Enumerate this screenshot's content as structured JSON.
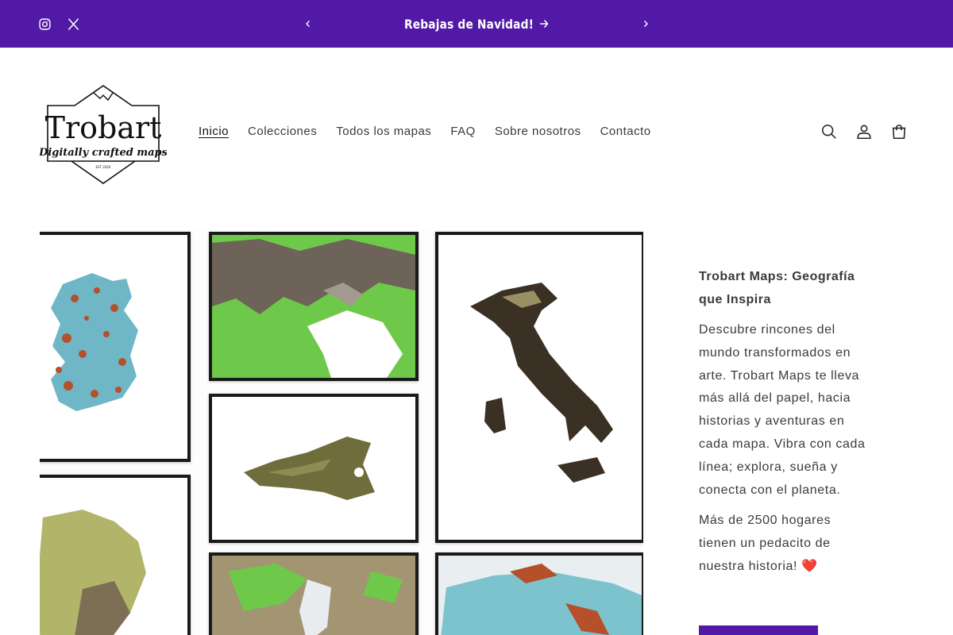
{
  "announcement": {
    "message": "Rebajas de Navidad!",
    "social": [
      "instagram-icon",
      "x-twitter-icon"
    ],
    "prev_icon": "chevron-left-icon",
    "next_icon": "chevron-right-icon",
    "arrow_icon": "arrow-right-icon"
  },
  "logo": {
    "title": "Trobart",
    "tagline": "Digitally crafted maps",
    "est": "EST 2020"
  },
  "nav": {
    "items": [
      {
        "label": "Inicio",
        "active": true
      },
      {
        "label": "Colecciones",
        "active": false
      },
      {
        "label": "Todos los mapas",
        "active": false
      },
      {
        "label": "FAQ",
        "active": false
      },
      {
        "label": "Sobre nosotros",
        "active": false
      },
      {
        "label": "Contacto",
        "active": false
      }
    ]
  },
  "header_icons": [
    "search-icon",
    "account-icon",
    "cart-icon"
  ],
  "hero": {
    "heading": "Trobart Maps: Geografía que Inspira",
    "paragraph1": "Descubre rincones del mundo transformados en arte. Trobart Maps te lleva más allá del papel, hacia historias y aventuras en cada mapa. Vibra con cada línea; explora, sueña y conecta con el planeta.",
    "paragraph2": "Más de 2500 hogares tienen un pedacito de nuestra historia! ❤️",
    "image": "framed-relief-maps-collage"
  },
  "colors": {
    "brand_purple": "#5119a6",
    "text": "#3a3a3a"
  }
}
